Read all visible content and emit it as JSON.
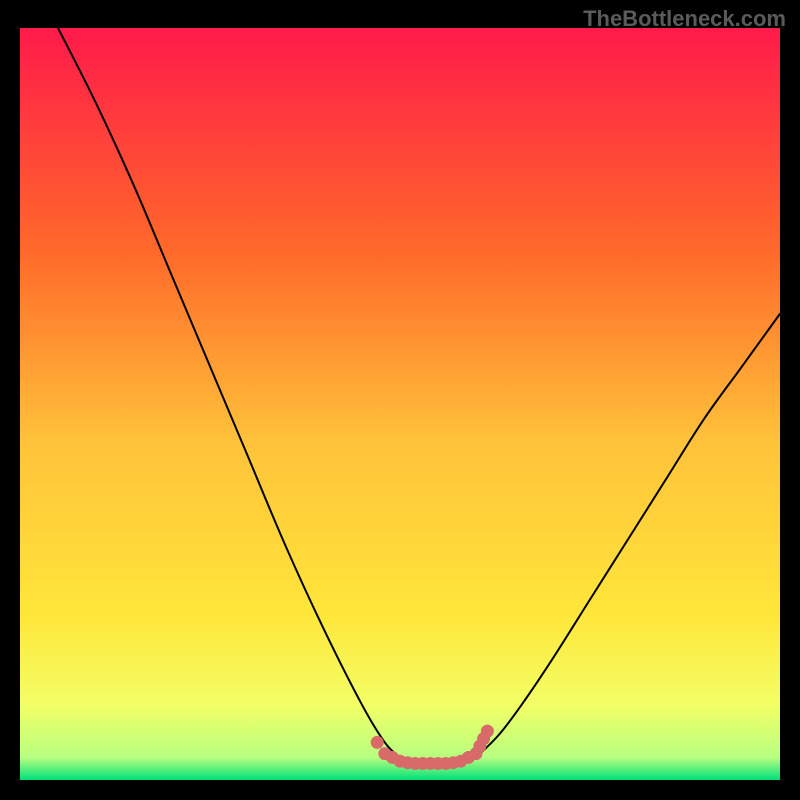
{
  "watermark": "TheBottleneck.com",
  "chart_data": {
    "type": "line",
    "title": "",
    "xlabel": "",
    "ylabel": "",
    "xlim": [
      0,
      100
    ],
    "ylim": [
      0,
      100
    ],
    "grid": false,
    "legend": false,
    "background_gradient": {
      "top": "#ff1a4a",
      "mid_upper": "#ff8a2a",
      "mid": "#ffe63a",
      "mid_lower": "#f3ff66",
      "bottom": "#00e07a"
    },
    "series": [
      {
        "name": "left-curve",
        "stroke": "#000000",
        "x": [
          5,
          10,
          15,
          20,
          25,
          30,
          35,
          40,
          45,
          48,
          50
        ],
        "y": [
          100,
          90,
          79,
          67,
          55,
          43,
          31,
          20,
          10,
          5,
          3
        ]
      },
      {
        "name": "right-curve",
        "stroke": "#000000",
        "x": [
          60,
          63,
          66,
          70,
          75,
          80,
          85,
          90,
          95,
          100
        ],
        "y": [
          3,
          6,
          10,
          16,
          24,
          32,
          40,
          48,
          55,
          62
        ]
      },
      {
        "name": "flat-bottom",
        "stroke": "#000000",
        "x": [
          50,
          52,
          54,
          56,
          58,
          60
        ],
        "y": [
          3,
          2.5,
          2.3,
          2.3,
          2.5,
          3
        ]
      }
    ],
    "scatter": {
      "name": "bottom-dots",
      "color": "#d86a6a",
      "x": [
        47,
        48,
        49,
        50,
        51,
        52,
        53,
        54,
        55,
        56,
        57,
        58,
        59,
        60,
        60.5,
        61,
        61.5
      ],
      "y": [
        5,
        3.5,
        3,
        2.5,
        2.3,
        2.2,
        2.2,
        2.2,
        2.2,
        2.2,
        2.3,
        2.5,
        3,
        3.5,
        4.5,
        5.5,
        6.5
      ]
    }
  }
}
